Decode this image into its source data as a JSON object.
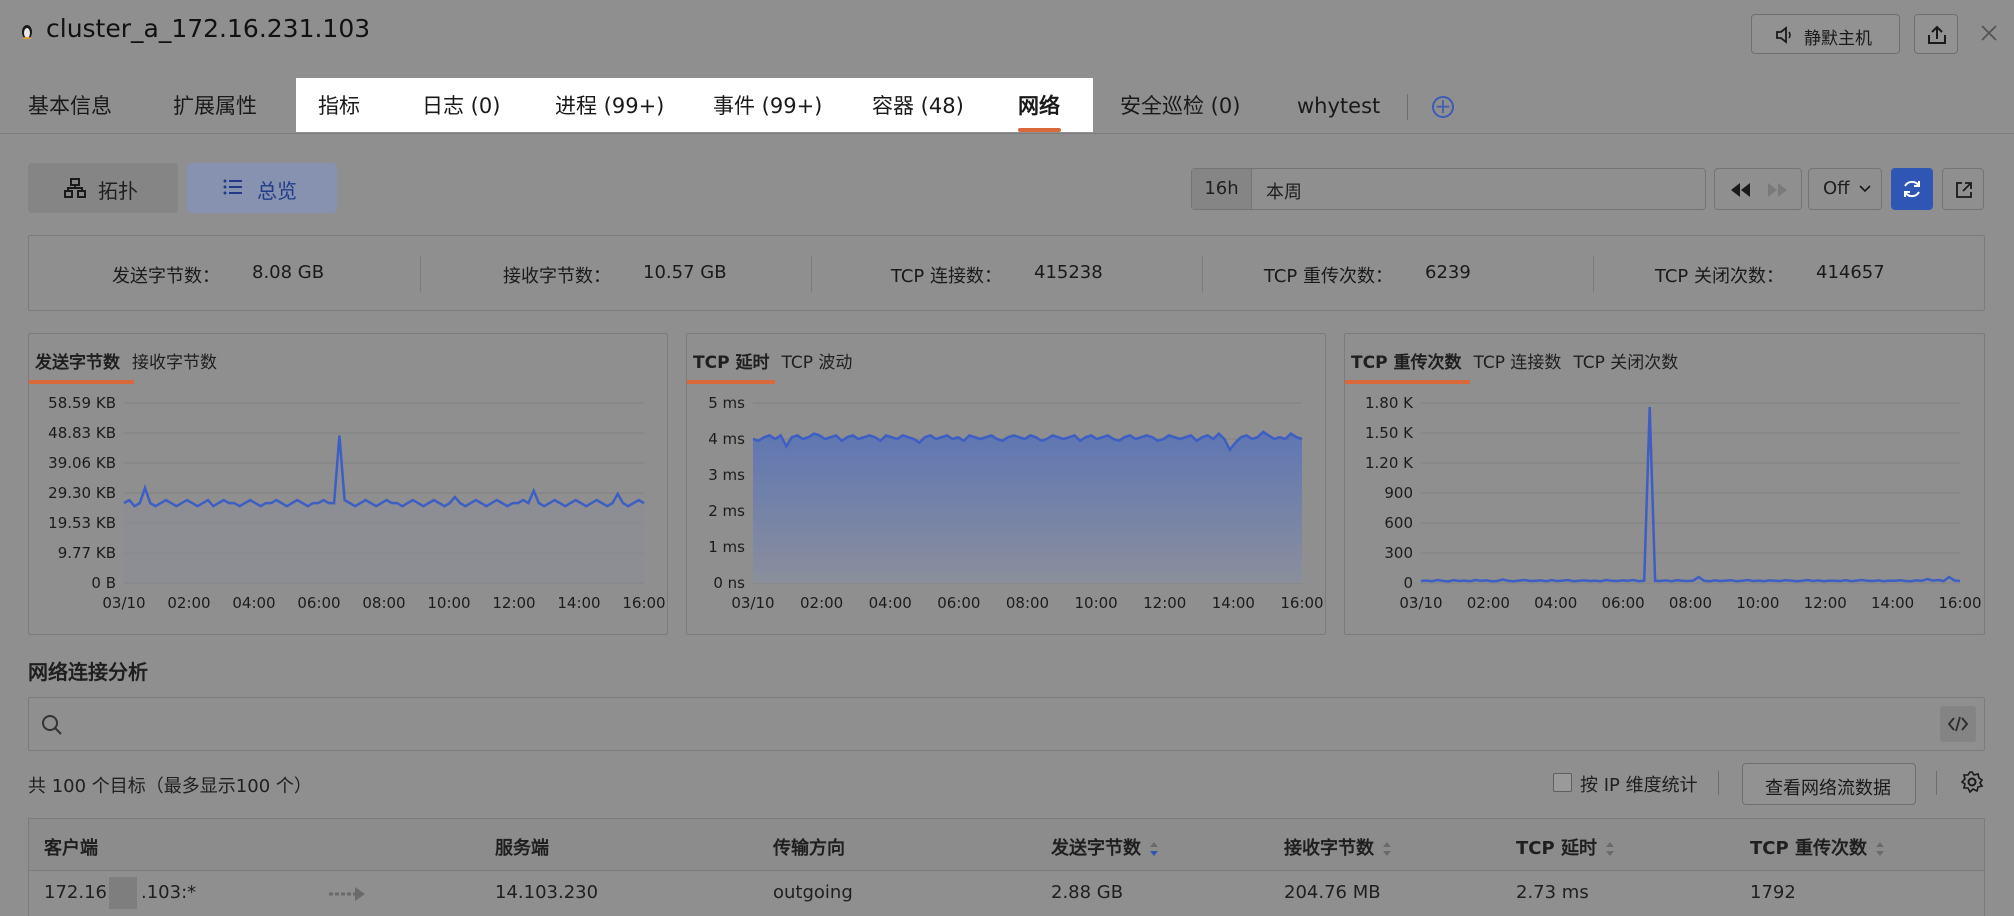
{
  "header": {
    "title": "cluster_a_172.16.231.103",
    "mute_label": "静默主机"
  },
  "tabs": [
    {
      "label": "基本信息"
    },
    {
      "label": "扩展属性"
    },
    {
      "label": "指标"
    },
    {
      "label": "日志 (0)"
    },
    {
      "label": "进程 (99+)"
    },
    {
      "label": "事件 (99+)"
    },
    {
      "label": "容器 (48)"
    },
    {
      "label": "网络",
      "active": true
    },
    {
      "label": "安全巡检 (0)"
    },
    {
      "label": "whytest"
    }
  ],
  "view_toggle": {
    "topology_label": "拓扑",
    "overview_label": "总览",
    "selected": "总览"
  },
  "time_range": {
    "preset": "16h",
    "value": "本周",
    "auto_refresh": "Off"
  },
  "stats": [
    {
      "label": "发送字节数：",
      "value": "8.08 GB"
    },
    {
      "label": "接收字节数：",
      "value": "10.57 GB"
    },
    {
      "label": "TCP 连接数：",
      "value": "415238"
    },
    {
      "label": "TCP 重传次数：",
      "value": "6239"
    },
    {
      "label": "TCP 关闭次数：",
      "value": "414657"
    }
  ],
  "chart_tabs": {
    "bytes": [
      "发送字节数",
      "接收字节数"
    ],
    "tcp": [
      "TCP 延时",
      "TCP 波动"
    ],
    "retrans": [
      "TCP 重传次数",
      "TCP 连接数",
      "TCP 关闭次数"
    ]
  },
  "chart_data": [
    {
      "type": "line",
      "series_color": "#3d5fc4",
      "x": [
        "03/10",
        "02:00",
        "04:00",
        "06:00",
        "08:00",
        "10:00",
        "12:00",
        "14:00",
        "16:00"
      ],
      "y_ticks": [
        "0 B",
        "9.77 KB",
        "19.53 KB",
        "29.30 KB",
        "39.06 KB",
        "48.83 KB",
        "58.59 KB"
      ],
      "ylim": [
        0,
        58.59
      ],
      "unit": "KB",
      "series": [
        {
          "values": [
            26,
            27,
            25,
            26,
            31,
            26,
            25,
            26,
            27,
            26,
            25,
            26,
            27,
            26,
            25,
            26,
            27,
            25,
            26,
            27,
            26,
            26,
            25,
            26,
            27,
            26,
            25,
            26,
            26,
            27,
            26,
            25,
            26,
            27,
            26,
            25,
            26,
            26,
            27,
            26,
            26,
            48,
            27,
            26,
            25,
            26,
            27,
            26,
            25,
            26,
            27,
            26,
            26,
            25,
            26,
            27,
            26,
            25,
            26,
            27,
            26,
            25,
            26,
            28,
            26,
            25,
            26,
            27,
            26,
            25,
            26,
            27,
            26,
            25,
            26,
            26,
            27,
            26,
            30,
            26,
            25,
            26,
            27,
            26,
            25,
            26,
            27,
            26,
            25,
            26,
            27,
            26,
            25,
            26,
            29,
            26,
            25,
            26,
            27,
            26
          ]
        }
      ]
    },
    {
      "type": "area",
      "series_color": "#3d5fc4",
      "x": [
        "03/10",
        "02:00",
        "04:00",
        "06:00",
        "08:00",
        "10:00",
        "12:00",
        "14:00",
        "16:00"
      ],
      "y_ticks": [
        "0 ns",
        "1 ms",
        "2 ms",
        "3 ms",
        "4 ms",
        "5 ms"
      ],
      "ylim": [
        0,
        5
      ],
      "unit": "ms",
      "series": [
        {
          "values": [
            4.0,
            3.95,
            4.05,
            4.1,
            4.0,
            4.1,
            3.8,
            4.05,
            4.1,
            4.0,
            4.05,
            4.15,
            4.1,
            4.0,
            4.05,
            4.1,
            3.95,
            4.05,
            4.1,
            4.0,
            4.05,
            4.1,
            4.05,
            3.95,
            4.1,
            4.05,
            4.0,
            4.1,
            4.05,
            4.0,
            3.9,
            4.05,
            4.1,
            4.0,
            4.05,
            4.1,
            4.0,
            4.05,
            3.95,
            4.1,
            4.05,
            4.0,
            4.05,
            4.1,
            4.0,
            3.95,
            4.05,
            4.1,
            4.05,
            4.0,
            4.1,
            4.05,
            3.95,
            4.0,
            4.1,
            4.05,
            4.0,
            4.05,
            4.1,
            3.95,
            4.05,
            4.1,
            4.0,
            4.05,
            4.1,
            4.0,
            3.95,
            4.05,
            4.1,
            4.0,
            4.05,
            4.1,
            4.05,
            3.95,
            4.0,
            4.1,
            4.05,
            4.0,
            4.05,
            4.1,
            3.95,
            4.05,
            4.1,
            4.0,
            4.15,
            4.0,
            3.7,
            3.9,
            4.05,
            4.1,
            4.0,
            4.05,
            4.2,
            4.1,
            4.0,
            4.05,
            4.0,
            4.15,
            4.05,
            4.0
          ]
        }
      ]
    },
    {
      "type": "line",
      "series_color": "#3d5fc4",
      "x": [
        "03/10",
        "02:00",
        "04:00",
        "06:00",
        "08:00",
        "10:00",
        "12:00",
        "14:00",
        "16:00"
      ],
      "y_ticks": [
        "0",
        "300",
        "600",
        "900",
        "1.20 K",
        "1.50 K",
        "1.80 K"
      ],
      "ylim": [
        0,
        1800
      ],
      "series": [
        {
          "values": [
            20,
            25,
            18,
            30,
            22,
            15,
            28,
            20,
            24,
            18,
            30,
            22,
            26,
            18,
            20,
            35,
            22,
            18,
            24,
            30,
            20,
            22,
            26,
            18,
            28,
            20,
            24,
            30,
            18,
            22,
            26,
            20,
            24,
            18,
            30,
            22,
            20,
            26,
            22,
            30,
            18,
            24,
            1760,
            22,
            20,
            26,
            18,
            28,
            22,
            20,
            24,
            60,
            22,
            18,
            26,
            20,
            24,
            28,
            18,
            22,
            30,
            20,
            24,
            18,
            26,
            22,
            20,
            28,
            24,
            18,
            22,
            30,
            20,
            26,
            18,
            24,
            22,
            20,
            28,
            18,
            24,
            30,
            22,
            20,
            26,
            18,
            24,
            22,
            28,
            20,
            18,
            26,
            22,
            40,
            24,
            30,
            20,
            60,
            25,
            20
          ]
        }
      ]
    }
  ],
  "analysis": {
    "title": "网络连接分析",
    "search_placeholder": "",
    "total_text": "共 100 个目标（最多显示100 个）",
    "ip_stat_label": "按 IP 维度统计",
    "flow_button": "查看网络流数据"
  },
  "table": {
    "columns": [
      "客户端",
      "服务端",
      "传输方向",
      "发送字节数",
      "接收字节数",
      "TCP 延时",
      "TCP 重传次数"
    ],
    "rows": [
      {
        "client": "172.16.",
        "client_suffix": ".103:*",
        "server": "14.103.230",
        "direction": "outgoing",
        "sent": "2.88 GB",
        "recv": "204.76 MB",
        "latency": "2.73 ms",
        "retrans": "1792"
      }
    ]
  }
}
